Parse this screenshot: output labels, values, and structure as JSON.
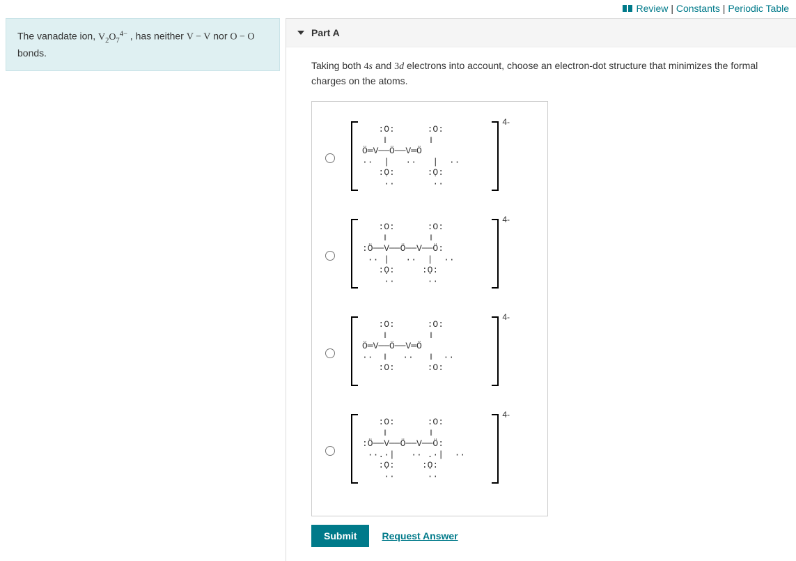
{
  "top_links": {
    "review": "Review",
    "constants": "Constants",
    "periodic_table": "Periodic Table"
  },
  "info_box": {
    "text_prefix": "The vanadate ion, ",
    "formula_html": "V₂O₇⁴⁻",
    "text_mid": " , has neither ",
    "bond1": "V − V",
    "text_mid2": " nor ",
    "bond2": "O − O",
    "text_suffix": " bonds."
  },
  "part": {
    "label": "Part A"
  },
  "question": {
    "prefix": "Taking both ",
    "orb1": "4s",
    "mid1": " and ",
    "orb2": "3d",
    "suffix": " electrons into account, choose an electron-dot structure that minimizes the formal charges on the atoms."
  },
  "options": {
    "charge_label": "4-",
    "structures": [
      "   :O:      :O:\n    ‖        ‖\nÖ═V──Ö──V═Ö\n··  |   ··   |  ··\n   :Ọ:      :Ọ:\n    ··       ··",
      "   :O:      :O:\n    ‖        ‖\n:Ö──V──Ö──V──Ö:\n ·· |   ··  |  ··\n   :Ọ:     :Ọ:\n    ··      ··",
      "   :O:      :O:\n    ‖        ‖\nÖ═V──Ö──V═Ö\n··  ‖   ··   ‖  ··\n   :O:      :O:",
      "   :O:      :O:\n    ‖        ‖\n:Ö──V──Ö──V──Ö:\n ··.·|   ·· .·|  ··\n   :Ọ:     :Ọ:\n    ··      ··"
    ]
  },
  "actions": {
    "submit": "Submit",
    "request": "Request Answer"
  }
}
